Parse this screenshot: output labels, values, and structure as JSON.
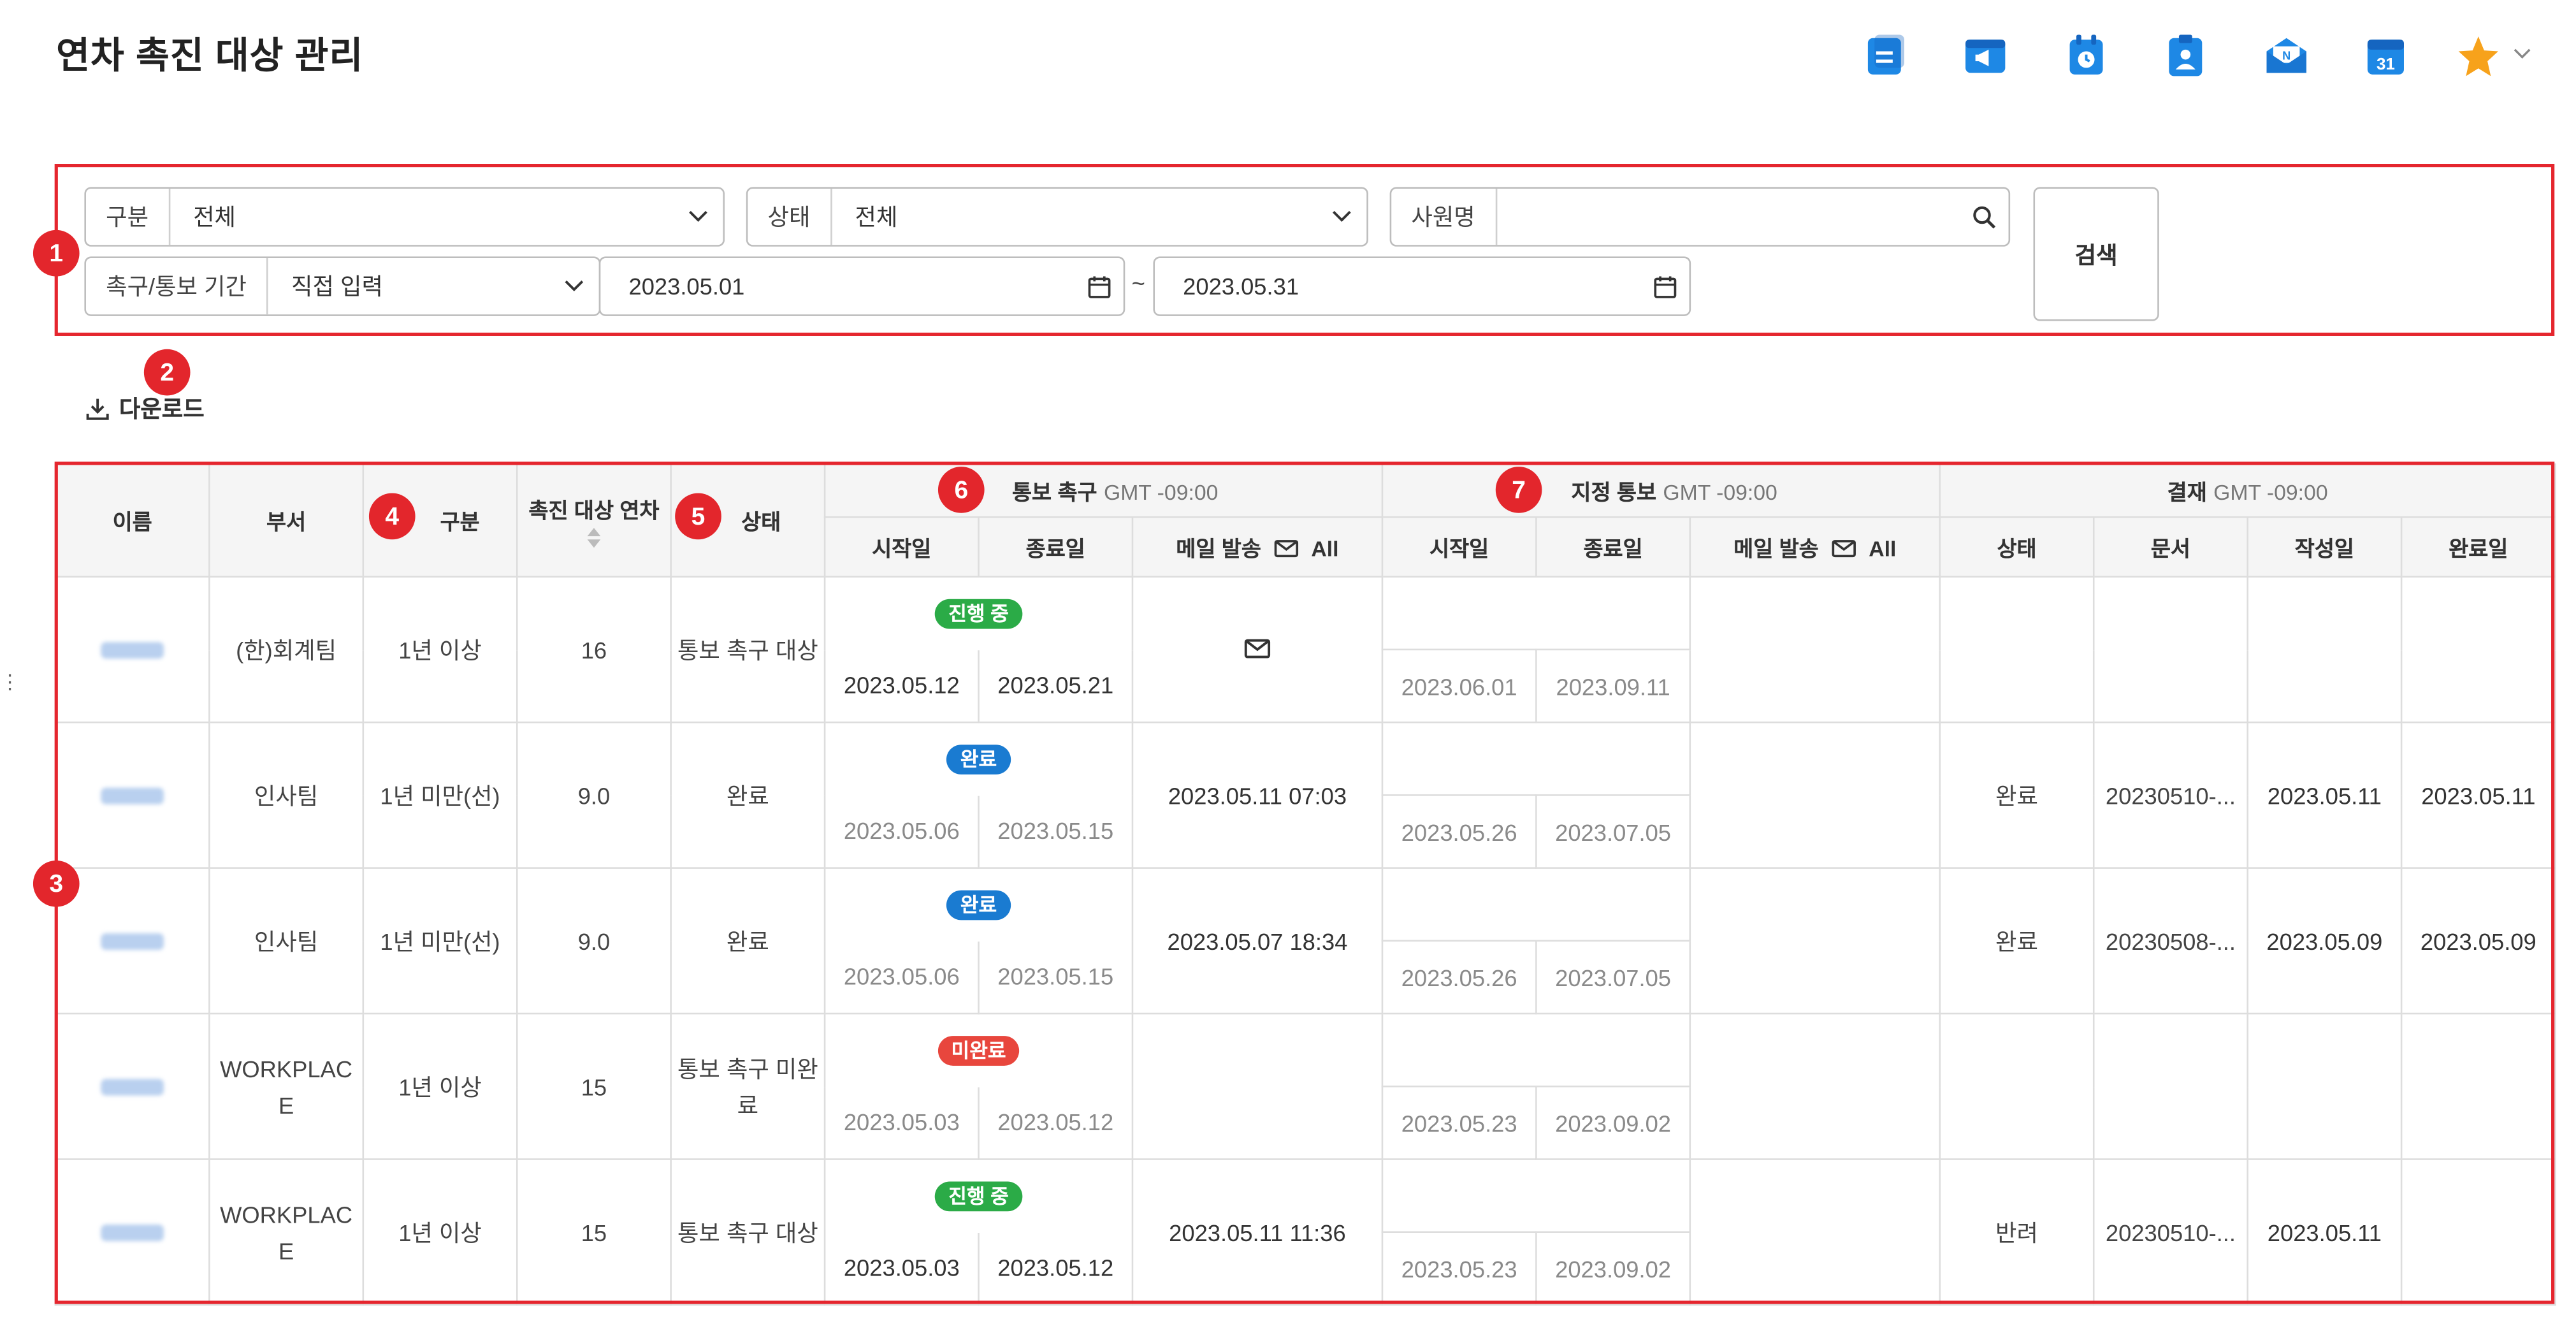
{
  "page": {
    "title": "연차 촉진 대상 관리"
  },
  "toolbar": {
    "icons": [
      "board-icon",
      "notice-icon",
      "attendance-icon",
      "approval-icon",
      "mail-icon",
      "calendar-icon",
      "favorite-star-icon"
    ],
    "calendar_day": "31",
    "favorite_color": "#f7a21b",
    "accent_color": "#1a7ad4"
  },
  "annotations": [
    "1",
    "2",
    "3",
    "4",
    "5",
    "6",
    "7"
  ],
  "filters": {
    "category": {
      "label": "구분",
      "value": "전체"
    },
    "status": {
      "label": "상태",
      "value": "전체"
    },
    "employee": {
      "label": "사원명",
      "value": ""
    },
    "period": {
      "label": "촉구/통보 기간",
      "mode": "직접 입력",
      "start": "2023.05.01",
      "separator": "~",
      "end": "2023.05.31"
    },
    "search_button": "검색"
  },
  "download_label": "다운로드",
  "table": {
    "headers": {
      "name": "이름",
      "dept": "부서",
      "category": "구분",
      "leave_days": "촉진 대상 연차",
      "status": "상태",
      "urge_group": "통보 촉구",
      "urge_gmt": "GMT -09:00",
      "designate_group": "지정 통보",
      "designate_gmt": "GMT -09:00",
      "approval_group": "결재",
      "approval_gmt": "GMT -09:00",
      "start": "시작일",
      "end": "종료일",
      "mail_send": "메일 발송",
      "mail_all": "All",
      "approval_status": "상태",
      "approval_doc": "문서",
      "approval_created": "작성일",
      "approval_completed": "완료일"
    },
    "rows": [
      {
        "dept": "(한)회계팀",
        "category": "1년 이상",
        "days": "16",
        "status": "통보 촉구 대상",
        "urge_state": "진행 중",
        "urge_color": "#2bab47",
        "urge_start": "2023.05.12",
        "urge_end": "2023.05.21",
        "urge_mail": "",
        "des_start": "2023.06.01",
        "des_end": "2023.09.11",
        "des_mail": "",
        "ap_status": "",
        "ap_doc": "",
        "ap_created": "",
        "ap_completed": ""
      },
      {
        "dept": "인사팀",
        "category": "1년 미만(선)",
        "days": "9.0",
        "status": "완료",
        "urge_state": "완료",
        "urge_color": "#1a7bd1",
        "urge_start": "2023.05.06",
        "urge_end": "2023.05.15",
        "urge_mail": "2023.05.11 07:03",
        "des_start": "2023.05.26",
        "des_end": "2023.07.05",
        "des_mail": "",
        "ap_status": "완료",
        "ap_doc": "20230510-...",
        "ap_created": "2023.05.11",
        "ap_completed": "2023.05.11"
      },
      {
        "dept": "인사팀",
        "category": "1년 미만(선)",
        "days": "9.0",
        "status": "완료",
        "urge_state": "완료",
        "urge_color": "#1a7bd1",
        "urge_start": "2023.05.06",
        "urge_end": "2023.05.15",
        "urge_mail": "2023.05.07 18:34",
        "des_start": "2023.05.26",
        "des_end": "2023.07.05",
        "des_mail": "",
        "ap_status": "완료",
        "ap_doc": "20230508-...",
        "ap_created": "2023.05.09",
        "ap_completed": "2023.05.09"
      },
      {
        "dept": "WORKPLAC\nE",
        "category": "1년 이상",
        "days": "15",
        "status": "통보 촉구 미완\n료",
        "urge_state": "미완료",
        "urge_color": "#e8463d",
        "urge_start": "2023.05.03",
        "urge_end": "2023.05.12",
        "urge_mail": "",
        "des_start": "2023.05.23",
        "des_end": "2023.09.02",
        "des_mail": "",
        "ap_status": "",
        "ap_doc": "",
        "ap_created": "",
        "ap_completed": ""
      },
      {
        "dept": "WORKPLAC\nE",
        "category": "1년 이상",
        "days": "15",
        "status": "통보 촉구 대상",
        "urge_state": "진행 중",
        "urge_color": "#2bab47",
        "urge_start": "2023.05.03",
        "urge_end": "2023.05.12",
        "urge_mail": "2023.05.11 11:36",
        "des_start": "2023.05.23",
        "des_end": "2023.09.02",
        "des_mail": "",
        "ap_status": "반려",
        "ap_doc": "20230510-...",
        "ap_created": "2023.05.11",
        "ap_completed": ""
      }
    ]
  }
}
